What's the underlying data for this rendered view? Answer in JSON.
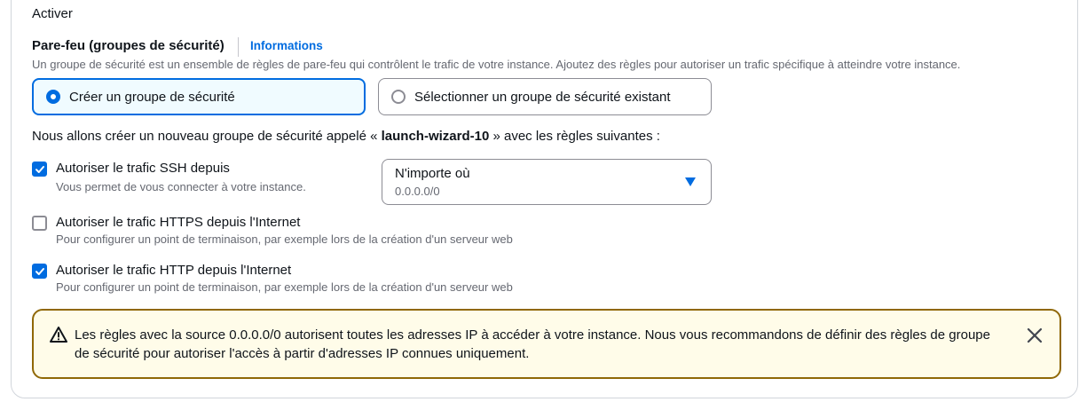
{
  "activation": {
    "label": "Activer"
  },
  "firewall": {
    "title": "Pare-feu (groupes de sécurité)",
    "info_link": "Informations",
    "description": "Un groupe de sécurité est un ensemble de règles de pare-feu qui contrôlent le trafic de votre instance. Ajoutez des règles pour autoriser un trafic spécifique à atteindre votre instance.",
    "options": [
      {
        "label": "Créer un groupe de sécurité",
        "selected": true
      },
      {
        "label": "Sélectionner un groupe de sécurité existant",
        "selected": false
      }
    ],
    "intro_prefix": "Nous allons créer un nouveau groupe de sécurité appelé « ",
    "group_name": "launch-wizard-10",
    "intro_suffix": " » avec les règles suivantes :"
  },
  "rules": [
    {
      "label": "Autoriser le trafic SSH depuis",
      "description": "Vous permet de vous connecter à votre instance.",
      "checked": true
    },
    {
      "label": "Autoriser le trafic HTTPS depuis l'Internet",
      "description": "Pour configurer un point de terminaison, par exemple lors de la création d'un serveur web",
      "checked": false
    },
    {
      "label": "Autoriser le trafic HTTP depuis l'Internet",
      "description": "Pour configurer un point de terminaison, par exemple lors de la création d'un serveur web",
      "checked": true
    }
  ],
  "ssh_source": {
    "value": "N'importe où",
    "sub": "0.0.0.0/0"
  },
  "warning": {
    "text": "Les règles avec la source 0.0.0.0/0 autorisent toutes les adresses IP à accéder à votre instance. Nous vous recommandons de définir des règles de groupe de sécurité pour autoriser l'accès à partir d'adresses IP connues uniquement."
  },
  "icons": {
    "warning": "warning-triangle-icon",
    "close": "close-icon",
    "dropdown": "caret-down-icon",
    "check": "checkmark-icon"
  },
  "colors": {
    "accent": "#006ce0",
    "warning_border": "#906806",
    "warning_bg": "#fffce9"
  }
}
